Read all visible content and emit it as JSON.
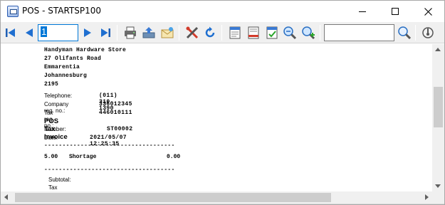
{
  "window": {
    "title": "POS - STARTSP100"
  },
  "toolbar": {
    "page_value": "1",
    "search_value": "",
    "icons": [
      "first-page-icon",
      "prev-page-icon",
      "next-page-icon",
      "last-page-icon",
      "print-icon",
      "export-icon",
      "email-icon",
      "tools-icon",
      "refresh-icon",
      "one-page-icon",
      "two-page-icon",
      "page-setup-icon",
      "zoom-out-icon",
      "zoom-in-icon",
      "search-icon",
      "close-preview-icon"
    ]
  },
  "receipt": {
    "address": [
      "Handyman Hardware Store",
      "27 Olifants Road",
      "Emmarentia",
      "Johannesburg",
      "2195"
    ],
    "telephone_label": "Telephone:",
    "telephone_value": "(011) 310-1390",
    "company_label": "Company reg. no.:",
    "company_value": "336012345",
    "tax_label": "Tax reg. no.:",
    "tax_value": "446010111",
    "invoice_title": "POS Tax Invoice",
    "number_label": "Number:",
    "number_value": "ST00002",
    "date_label": "Date:",
    "date_value": "2021/05/07 12:25:35",
    "separator": "------------------------------------",
    "item_qty": "5.00",
    "item_desc": "Shortage",
    "item_amount": "0.00",
    "subtotal_label": "Subtotal:",
    "tax_pct_label": "Tax % :"
  }
}
